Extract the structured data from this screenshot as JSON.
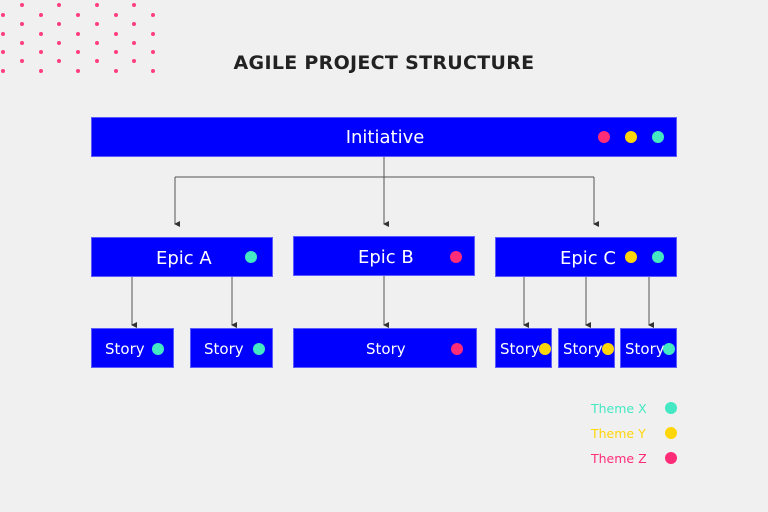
{
  "title": "AGILE PROJECT STRUCTURE",
  "themes": {
    "X": {
      "label": "Theme X",
      "color": "#44e8c3"
    },
    "Y": {
      "label": "Theme Y",
      "color": "#ffd60a"
    },
    "Z": {
      "label": "Theme Z",
      "color": "#ff2d78"
    }
  },
  "initiative": {
    "label": "Initiative",
    "themes": [
      "Z",
      "Y",
      "X"
    ]
  },
  "epics": [
    {
      "label": "Epic A",
      "themes": [
        "X"
      ],
      "stories": [
        {
          "label": "Story",
          "themes": [
            "X"
          ]
        },
        {
          "label": "Story",
          "themes": [
            "X"
          ]
        }
      ]
    },
    {
      "label": "Epic B",
      "themes": [
        "Z"
      ],
      "stories": [
        {
          "label": "Story",
          "themes": [
            "Z"
          ]
        }
      ]
    },
    {
      "label": "Epic C",
      "themes": [
        "Y",
        "X"
      ],
      "stories": [
        {
          "label": "Story",
          "themes": [
            "Y"
          ]
        },
        {
          "label": "Story",
          "themes": [
            "Y"
          ]
        },
        {
          "label": "Story",
          "themes": [
            "X"
          ]
        }
      ]
    }
  ],
  "legend": [
    "X",
    "Y",
    "Z"
  ],
  "colors": {
    "node": "#0000ff",
    "background": "#f0f0f0",
    "decor_dot": "#ff3d7f"
  }
}
